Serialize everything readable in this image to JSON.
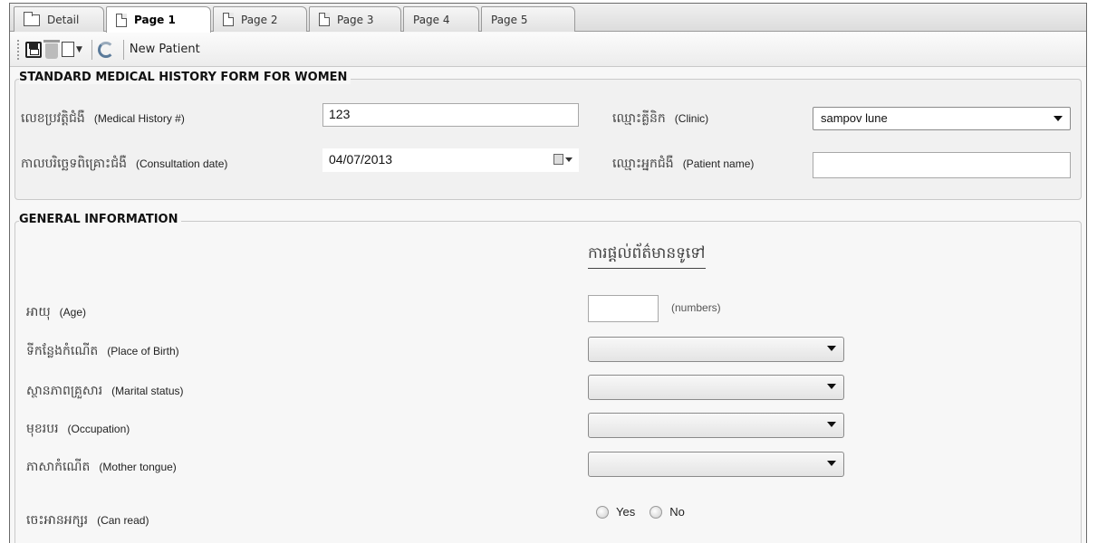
{
  "tabs": [
    {
      "label": "Detail",
      "icon": "folder-icon"
    },
    {
      "label": "Page 1",
      "icon": "document-icon",
      "active": true
    },
    {
      "label": "Page 2",
      "icon": "document-icon"
    },
    {
      "label": "Page 3",
      "icon": "document-icon"
    },
    {
      "label": "Page 4"
    },
    {
      "label": "Page 5"
    }
  ],
  "toolbar": {
    "new_patient_label": "New Patient"
  },
  "section1": {
    "title": "STANDARD MEDICAL HISTORY FORM FOR WOMEN",
    "history_no": {
      "khmer": "លេខប្រវត្តិជំងឺ",
      "en": "(Medical History #)",
      "value": "123"
    },
    "consult_date": {
      "khmer": "កាលបរិច្ឆេទពិគ្រោះជំងឺ",
      "en": "(Consultation date)",
      "value": "04/07/2013"
    },
    "clinic": {
      "khmer": "ឈ្មោះគ្លីនិក",
      "en": "(Clinic)",
      "value": "sampov lune"
    },
    "patient_name": {
      "khmer": "ឈ្មោះអ្នកជំងឺ",
      "en": "(Patient name)",
      "value": ""
    }
  },
  "section2": {
    "title": "GENERAL INFORMATION",
    "heading_khmer": "ការផ្ដល់ព័ត៌មានទូទៅ",
    "age": {
      "khmer": "អាយុ",
      "en": "(Age)",
      "value": "",
      "hint": "(numbers)"
    },
    "place_of_birth": {
      "khmer": "ទីកន្លែងកំណើត",
      "en": "(Place of Birth)",
      "value": ""
    },
    "marital_status": {
      "khmer": "ស្ថានភាពគ្រួសារ",
      "en": "(Marital status)",
      "value": ""
    },
    "occupation": {
      "khmer": "មុខរបរ",
      "en": "(Occupation)",
      "value": ""
    },
    "mother_tongue": {
      "khmer": "ភាសាកំណើត",
      "en": "(Mother tongue)",
      "value": ""
    },
    "can_read": {
      "khmer": "ចេះអានអក្សរ",
      "en": "(Can read)",
      "options": [
        "Yes",
        "No"
      ]
    }
  }
}
